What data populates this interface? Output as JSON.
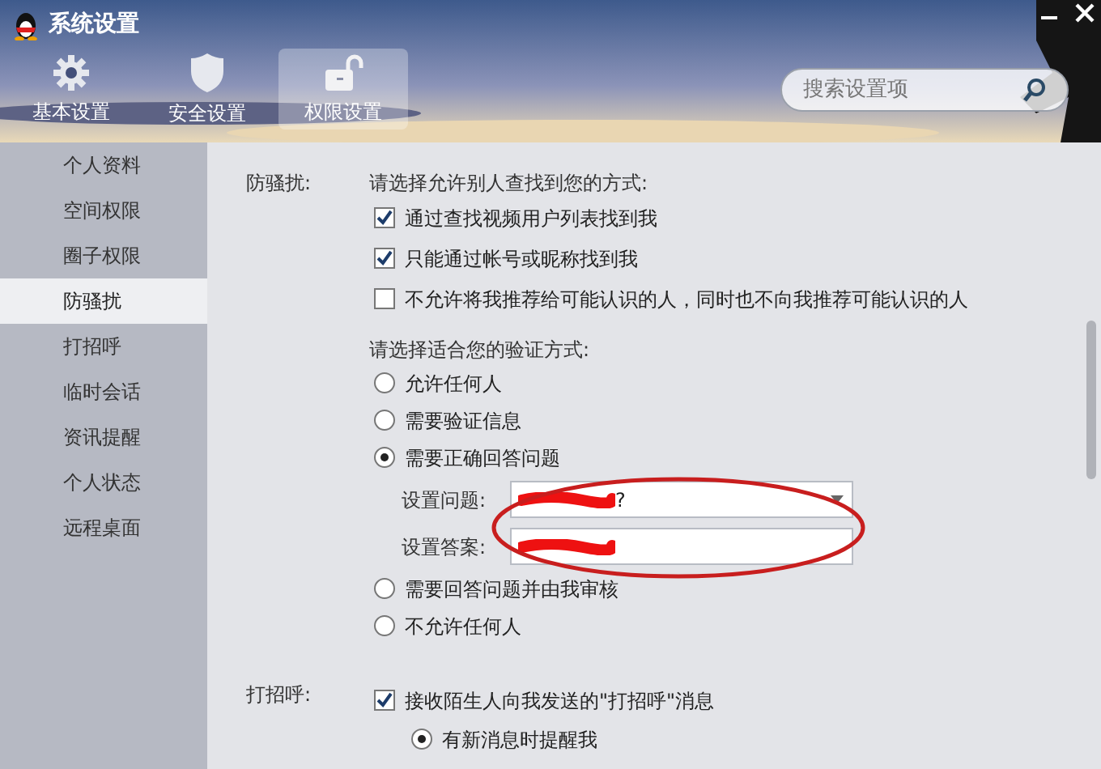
{
  "window": {
    "title": "系统设置"
  },
  "toolbar": [
    {
      "label": "基本设置",
      "selected": false
    },
    {
      "label": "安全设置",
      "selected": false
    },
    {
      "label": "权限设置",
      "selected": true
    }
  ],
  "search": {
    "placeholder": "搜索设置项"
  },
  "sidebar": {
    "items": [
      {
        "label": "个人资料",
        "selected": false
      },
      {
        "label": "空间权限",
        "selected": false
      },
      {
        "label": "圈子权限",
        "selected": false
      },
      {
        "label": "防骚扰",
        "selected": true
      },
      {
        "label": "打招呼",
        "selected": false
      },
      {
        "label": "临时会话",
        "selected": false
      },
      {
        "label": "资讯提醒",
        "selected": false
      },
      {
        "label": "个人状态",
        "selected": false
      },
      {
        "label": "远程桌面",
        "selected": false
      }
    ]
  },
  "sections": [
    {
      "label": "防骚扰:",
      "rows": [
        {
          "kind": "heading",
          "text": "请选择允许别人查找到您的方式:"
        },
        {
          "kind": "checkbox",
          "text": "通过查找视频用户列表找到我",
          "checked": true
        },
        {
          "kind": "checkbox",
          "text": "只能通过帐号或昵称找到我",
          "checked": true
        },
        {
          "kind": "checkbox",
          "text": "不允许将我推荐给可能认识的人，同时也不向我推荐可能认识的人",
          "checked": false
        },
        {
          "kind": "heading",
          "text": "请选择适合您的验证方式:"
        },
        {
          "kind": "radio",
          "text": "允许任何人",
          "selected": false
        },
        {
          "kind": "radio",
          "text": "需要验证信息",
          "selected": false
        },
        {
          "kind": "radio",
          "text": "需要正确回答问题",
          "selected": true
        },
        {
          "kind": "dropdown",
          "text": "设置问题:",
          "value": "?"
        },
        {
          "kind": "field",
          "text": "设置答案:"
        },
        {
          "kind": "radio",
          "text": "需要回答问题并由我审核",
          "selected": false
        },
        {
          "kind": "radio",
          "text": "不允许任何人",
          "selected": false
        }
      ]
    },
    {
      "label": "打招呼:",
      "rows": [
        {
          "kind": "checkbox",
          "text": "接收陌生人向我发送的\"打招呼\"消息",
          "checked": true
        },
        {
          "kind": "subradio",
          "text": "有新消息时提醒我",
          "selected": true
        }
      ]
    }
  ]
}
